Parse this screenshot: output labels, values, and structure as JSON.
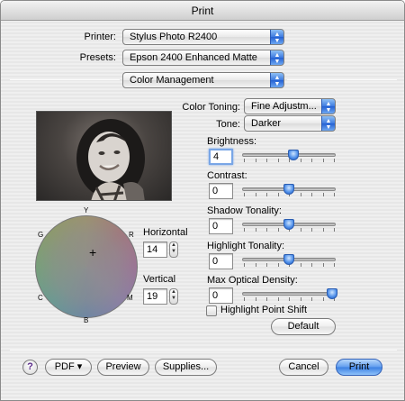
{
  "window": {
    "title": "Print"
  },
  "printer": {
    "label": "Printer:",
    "value": "Stylus Photo R2400"
  },
  "presets": {
    "label": "Presets:",
    "value": "Epson 2400 Enhanced Matte"
  },
  "panel": {
    "value": "Color Management"
  },
  "color_toning": {
    "label": "Color Toning:",
    "value": "Fine Adjustm..."
  },
  "tone": {
    "label": "Tone:",
    "value": "Darker"
  },
  "sliders": [
    {
      "label": "Brightness:",
      "value": "4",
      "level": 0.55
    },
    {
      "label": "Contrast:",
      "value": "0",
      "level": 0.5
    },
    {
      "label": "Shadow Tonality:",
      "value": "0",
      "level": 0.5
    },
    {
      "label": "Highlight Tonality:",
      "value": "0",
      "level": 0.5
    },
    {
      "label": "Max Optical Density:",
      "value": "0",
      "level": 1.0
    }
  ],
  "highlight_shift": {
    "label": "Highlight Point Shift",
    "checked": false
  },
  "default_button": "Default",
  "wheel": {
    "labels": {
      "y": "Y",
      "r": "R",
      "m": "M",
      "b": "B",
      "c": "C",
      "g": "G"
    }
  },
  "horizontal": {
    "label": "Horizontal",
    "value": "14"
  },
  "vertical": {
    "label": "Vertical",
    "value": "19"
  },
  "footer": {
    "help": "?",
    "pdf": "PDF ▾",
    "preview": "Preview",
    "supplies": "Supplies...",
    "cancel": "Cancel",
    "print": "Print"
  },
  "icons": {
    "popup_arrows": "updown-arrows-icon",
    "help": "help-icon",
    "crosshair": "crosshair-icon",
    "stepper": "stepper-arrows-icon"
  }
}
